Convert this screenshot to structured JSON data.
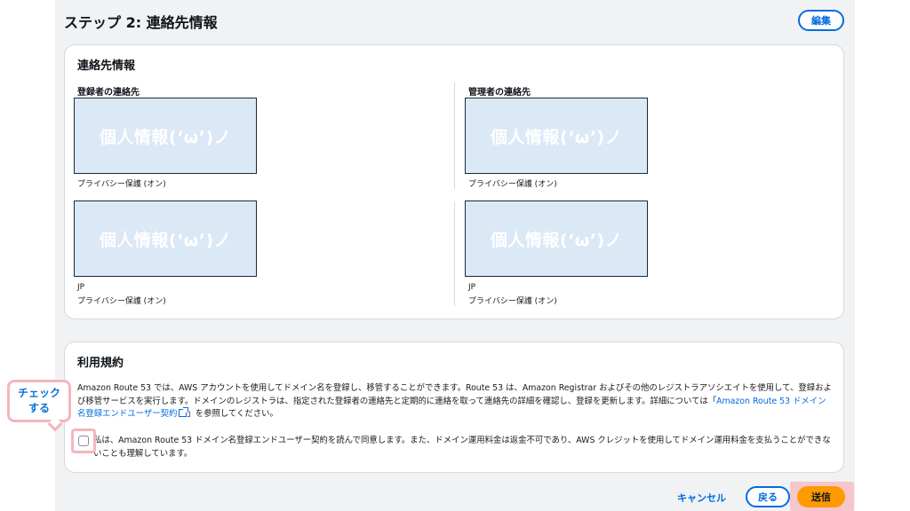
{
  "header": {
    "title": "ステップ 2: 連絡先情報",
    "edit_label": "編集"
  },
  "contact": {
    "title": "連絡先情報",
    "registrant": {
      "label": "登録者の連絡先",
      "mask1": "個人情報(‘ω’)ノ",
      "privacy1": "プライバシー保護 (オン)",
      "mask2": "個人情報(‘ω’)ノ",
      "country": "JP",
      "privacy2": "プライバシー保護 (オン)"
    },
    "admin": {
      "label": "管理者の連絡先",
      "mask1": "個人情報(‘ω’)ノ",
      "privacy1": "プライバシー保護 (オン)",
      "mask2": "個人情報(‘ω’)ノ",
      "country": "JP",
      "privacy2": "プライバシー保護 (オン)"
    }
  },
  "terms": {
    "title": "利用規約",
    "body_pre": "Amazon Route 53 では、AWS アカウントを使用してドメイン名を登録し、移管することができます。Route 53 は、Amazon Registrar およびその他のレジストラアソシエイトを使用して、登録および移管サービスを実行します。ドメインのレジストラは、指定された登録者の連絡先と定期的に連絡を取って連絡先の詳細を確認し、登録を更新します。詳細については「",
    "link_label": "Amazon Route 53 ドメイン名登録エンドユーザー契約",
    "body_post": "」を参照してください。",
    "agree_label": "私は、Amazon Route 53 ドメイン名登録エンドユーザー契約を読んで同意します。また、ドメイン運用料金は返金不可であり、AWS クレジットを使用してドメイン運用料金を支払うことができないことも理解しています。"
  },
  "callout": {
    "line1": "チェック",
    "line2": "する"
  },
  "footer": {
    "cancel_label": "キャンセル",
    "back_label": "戻る",
    "submit_label": "送信"
  },
  "colors": {
    "accent": "#006ce0",
    "primary_button": "#ff9900",
    "highlight": "#f4b6be"
  }
}
